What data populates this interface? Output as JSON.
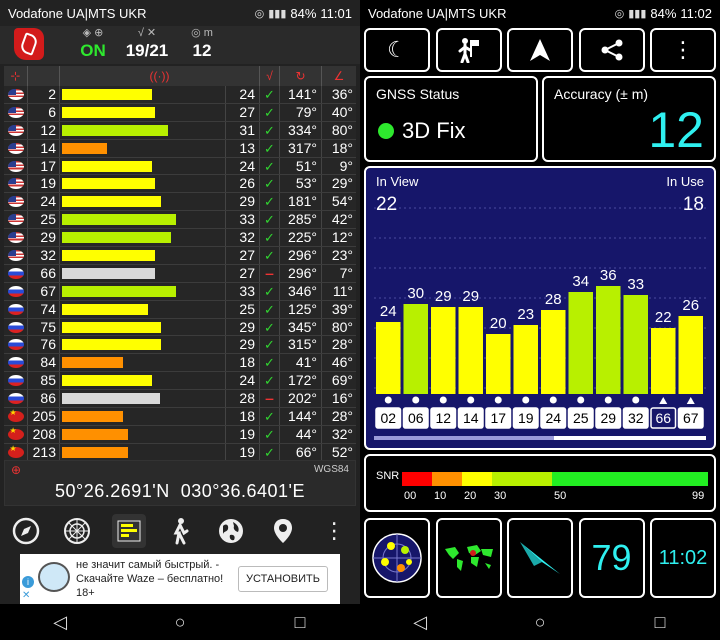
{
  "left": {
    "status": {
      "carrier": "Vodafone UA|MTS UKR",
      "battery": "84%",
      "time": "11:01"
    },
    "header": {
      "fix_state": "ON",
      "sats": "19/21",
      "accuracy": "12",
      "accuracy_unit": "m"
    },
    "table_headers": [
      "",
      "",
      "",
      "",
      "",
      ""
    ],
    "satellites": [
      {
        "flag": "us",
        "prn": "2",
        "snr": "24",
        "used": true,
        "az": "141°",
        "el": "36°",
        "color": "#ffff00",
        "level": 0.56
      },
      {
        "flag": "us",
        "prn": "6",
        "snr": "27",
        "used": true,
        "az": "79°",
        "el": "40°",
        "color": "#ffff00",
        "level": 0.58
      },
      {
        "flag": "us",
        "prn": "12",
        "snr": "31",
        "used": true,
        "az": "334°",
        "el": "80°",
        "color": "#b8f000",
        "level": 0.66
      },
      {
        "flag": "us",
        "prn": "14",
        "snr": "13",
        "used": true,
        "az": "317°",
        "el": "18°",
        "color": "#ff9000",
        "level": 0.28
      },
      {
        "flag": "us",
        "prn": "17",
        "snr": "24",
        "used": true,
        "az": "51°",
        "el": "9°",
        "color": "#ffff00",
        "level": 0.56
      },
      {
        "flag": "us",
        "prn": "19",
        "snr": "26",
        "used": true,
        "az": "53°",
        "el": "29°",
        "color": "#ffff00",
        "level": 0.58
      },
      {
        "flag": "us",
        "prn": "24",
        "snr": "29",
        "used": true,
        "az": "181°",
        "el": "54°",
        "color": "#ffff00",
        "level": 0.62
      },
      {
        "flag": "us",
        "prn": "25",
        "snr": "33",
        "used": true,
        "az": "285°",
        "el": "42°",
        "color": "#b8f000",
        "level": 0.71
      },
      {
        "flag": "us",
        "prn": "29",
        "snr": "32",
        "used": true,
        "az": "225°",
        "el": "12°",
        "color": "#b8f000",
        "level": 0.68
      },
      {
        "flag": "us",
        "prn": "32",
        "snr": "27",
        "used": true,
        "az": "296°",
        "el": "23°",
        "color": "#ffff00",
        "level": 0.58
      },
      {
        "flag": "ru",
        "prn": "66",
        "snr": "27",
        "used": false,
        "az": "296°",
        "el": "7°",
        "color": "#d8d8d8",
        "level": 0.58
      },
      {
        "flag": "ru",
        "prn": "67",
        "snr": "33",
        "used": true,
        "az": "346°",
        "el": "11°",
        "color": "#b8f000",
        "level": 0.71
      },
      {
        "flag": "ru",
        "prn": "74",
        "snr": "25",
        "used": true,
        "az": "125°",
        "el": "39°",
        "color": "#ffff00",
        "level": 0.54
      },
      {
        "flag": "ru",
        "prn": "75",
        "snr": "29",
        "used": true,
        "az": "345°",
        "el": "80°",
        "color": "#ffff00",
        "level": 0.62
      },
      {
        "flag": "ru",
        "prn": "76",
        "snr": "29",
        "used": true,
        "az": "315°",
        "el": "28°",
        "color": "#ffff00",
        "level": 0.62
      },
      {
        "flag": "ru",
        "prn": "84",
        "snr": "18",
        "used": true,
        "az": "41°",
        "el": "46°",
        "color": "#ff9000",
        "level": 0.38
      },
      {
        "flag": "ru",
        "prn": "85",
        "snr": "24",
        "used": true,
        "az": "172°",
        "el": "69°",
        "color": "#ffff00",
        "level": 0.56
      },
      {
        "flag": "ru",
        "prn": "86",
        "snr": "28",
        "used": false,
        "az": "202°",
        "el": "16°",
        "color": "#d8d8d8",
        "level": 0.61
      },
      {
        "flag": "cn",
        "prn": "205",
        "snr": "18",
        "used": true,
        "az": "144°",
        "el": "28°",
        "color": "#ff9000",
        "level": 0.38
      },
      {
        "flag": "cn",
        "prn": "208",
        "snr": "19",
        "used": true,
        "az": "44°",
        "el": "32°",
        "color": "#ff9000",
        "level": 0.41
      },
      {
        "flag": "cn",
        "prn": "213",
        "snr": "19",
        "used": true,
        "az": "66°",
        "el": "52°",
        "color": "#ff9000",
        "level": 0.41
      }
    ],
    "coords": {
      "datum": "WGS84",
      "lat": "50°26.2691'N",
      "lon": "030°36.6401'E"
    },
    "ad": {
      "text": "не значит самый быстрый. - Скачайте Waze – бесплатно! 18+",
      "button": "УСТАНОВИТЬ"
    }
  },
  "right": {
    "status": {
      "carrier": "Vodafone UA|MTS UKR",
      "battery": "84%",
      "time": "11:02"
    },
    "gnss": {
      "title": "GNSS Status",
      "fix": "3D Fix"
    },
    "accuracy": {
      "title": "Accuracy (± m)",
      "value": "12"
    },
    "sky": {
      "in_view_label": "In View",
      "in_view": "22",
      "in_use_label": "In Use",
      "in_use": "18"
    },
    "snr_label": "SNR",
    "snr_scale": [
      "00",
      "10",
      "20",
      "30",
      "50",
      "99"
    ],
    "tile_value": "79",
    "tile_time": "11:02"
  },
  "chart_data": {
    "type": "bar",
    "categories": [
      "02",
      "06",
      "12",
      "14",
      "17",
      "19",
      "24",
      "25",
      "29",
      "32",
      "66",
      "67"
    ],
    "values": [
      24,
      30,
      29,
      29,
      20,
      23,
      28,
      34,
      36,
      33,
      22,
      26
    ],
    "markers": [
      "dot",
      "dot",
      "dot",
      "dot",
      "dot",
      "dot",
      "dot",
      "dot",
      "dot",
      "dot",
      "triangle",
      "triangle"
    ],
    "boxed": [
      false,
      false,
      false,
      false,
      false,
      false,
      false,
      false,
      false,
      false,
      true,
      false
    ],
    "colors": [
      "#ffff00",
      "#b8f000",
      "#ffff00",
      "#ffff00",
      "#ffff00",
      "#ffff00",
      "#ffff00",
      "#b8f000",
      "#b8f000",
      "#b8f000",
      "#ffff00",
      "#ffff00"
    ],
    "ylim": [
      0,
      99
    ],
    "title": "",
    "xlabel": "",
    "ylabel": ""
  }
}
